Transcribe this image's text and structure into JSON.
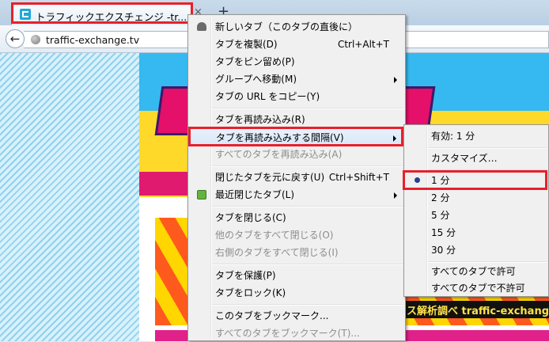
{
  "tab": {
    "title": "トラフィックエクスチェンジ -tr...",
    "close_label": "×",
    "new_tab_label": "+"
  },
  "navbar": {
    "back_label": "←",
    "url": "traffic-exchange.tv"
  },
  "page": {
    "ad_ticker": "ス解析調べ   traffic-exchange"
  },
  "context_menu": {
    "items": [
      {
        "label": "新しいタブ（このタブの直後に）",
        "shortcut": "",
        "disabled": false
      },
      {
        "label": "タブを複製(D)",
        "shortcut": "Ctrl+Alt+T",
        "disabled": false
      },
      {
        "label": "タブをピン留め(P)",
        "shortcut": "",
        "disabled": false
      },
      {
        "label": "グループへ移動(M)",
        "shortcut": "",
        "disabled": false,
        "submenu": true
      },
      {
        "label": "タブの URL をコピー(Y)",
        "shortcut": "",
        "disabled": false
      },
      {
        "label": "タブを再読み込み(R)",
        "shortcut": "",
        "disabled": false
      },
      {
        "label": "タブを再読み込みする間隔(V)",
        "shortcut": "",
        "disabled": false,
        "submenu": true
      },
      {
        "label": "すべてのタブを再読み込み(A)",
        "shortcut": "",
        "disabled": true
      },
      {
        "label": "閉じたタブを元に戻す(U)",
        "shortcut": "Ctrl+Shift+T",
        "disabled": false
      },
      {
        "label": "最近閉じたタブ(L)",
        "shortcut": "",
        "disabled": false,
        "submenu": true
      },
      {
        "label": "タブを閉じる(C)",
        "shortcut": "",
        "disabled": false
      },
      {
        "label": "他のタブをすべて閉じる(O)",
        "shortcut": "",
        "disabled": true
      },
      {
        "label": "右側のタブをすべて閉じる(I)",
        "shortcut": "",
        "disabled": true
      },
      {
        "label": "タブを保護(P)",
        "shortcut": "",
        "disabled": false
      },
      {
        "label": "タブをロック(K)",
        "shortcut": "",
        "disabled": false
      },
      {
        "label": "このタブをブックマーク...",
        "shortcut": "",
        "disabled": false
      },
      {
        "label": "すべてのタブをブックマーク(T)...",
        "shortcut": "",
        "disabled": true
      }
    ]
  },
  "submenu": {
    "items": [
      {
        "label": "有効: 1 分",
        "selected": false
      },
      {
        "label": "カスタマイズ…",
        "selected": false
      },
      {
        "label": "1  分",
        "selected": true
      },
      {
        "label": "2  分",
        "selected": false
      },
      {
        "label": "5  分",
        "selected": false
      },
      {
        "label": "15 分",
        "selected": false
      },
      {
        "label": "30 分",
        "selected": false
      },
      {
        "label": "すべてのタブで許可",
        "selected": false
      },
      {
        "label": "すべてのタブで不許可",
        "selected": false
      }
    ]
  },
  "colors": {
    "highlight_border": "#e8202a",
    "menu_background": "#f0f0f0",
    "disabled_text": "#8d8d8d"
  }
}
